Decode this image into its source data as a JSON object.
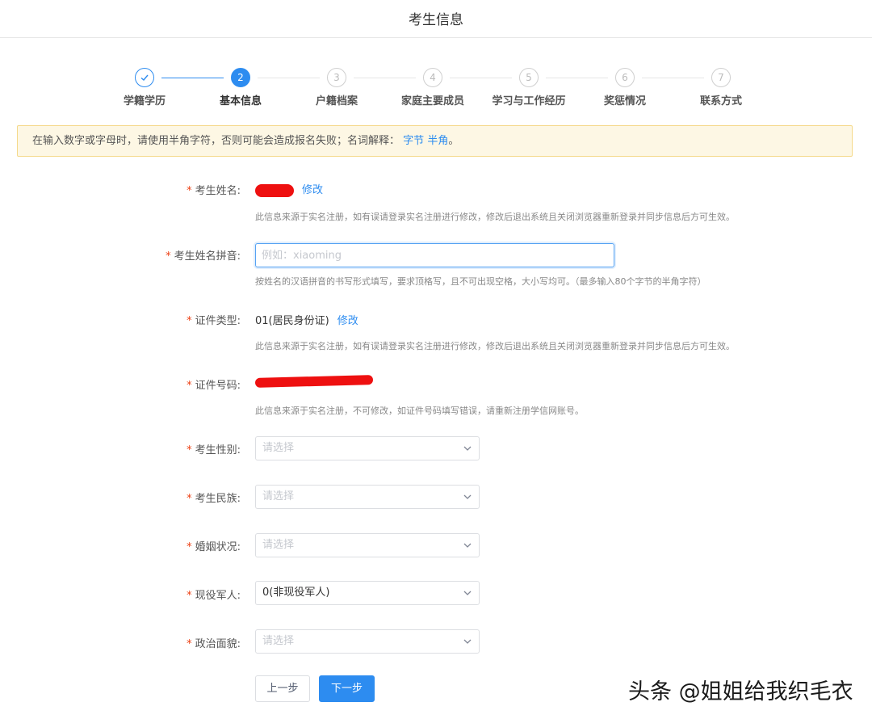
{
  "header": {
    "title": "考生信息"
  },
  "steps": [
    {
      "label": "学籍学历",
      "number": "✓",
      "state": "done"
    },
    {
      "label": "基本信息",
      "number": "2",
      "state": "active"
    },
    {
      "label": "户籍档案",
      "number": "3",
      "state": "pending"
    },
    {
      "label": "家庭主要成员",
      "number": "4",
      "state": "pending"
    },
    {
      "label": "学习与工作经历",
      "number": "5",
      "state": "pending"
    },
    {
      "label": "奖惩情况",
      "number": "6",
      "state": "pending"
    },
    {
      "label": "联系方式",
      "number": "7",
      "state": "pending"
    }
  ],
  "notice": {
    "text": "在输入数字或字母时，请使用半角字符，否则可能会造成报名失败；名词解释：",
    "link_byte": "字节",
    "link_halfwidth": "半角",
    "suffix": "。"
  },
  "form": {
    "required_mark": "*",
    "name": {
      "label": "考生姓名:",
      "edit_link": "修改",
      "hint": "此信息来源于实名注册，如有误请登录实名注册进行修改，修改后退出系统且关闭浏览器重新登录并同步信息后方可生效。"
    },
    "pinyin": {
      "label": "考生姓名拼音:",
      "placeholder": "例如：xiaoming",
      "hint": "按姓名的汉语拼音的书写形式填写，要求顶格写，且不可出现空格，大小写均可。（最多输入80个字节的半角字符）"
    },
    "id_type": {
      "label": "证件类型:",
      "value": "01(居民身份证)",
      "edit_link": "修改",
      "hint": "此信息来源于实名注册，如有误请登录实名注册进行修改，修改后退出系统且关闭浏览器重新登录并同步信息后方可生效。"
    },
    "id_number": {
      "label": "证件号码:",
      "hint": "此信息来源于实名注册，不可修改，如证件号码填写错误，请重新注册学信网账号。"
    },
    "gender": {
      "label": "考生性别:",
      "placeholder": "请选择"
    },
    "ethnicity": {
      "label": "考生民族:",
      "placeholder": "请选择"
    },
    "marital": {
      "label": "婚姻状况:",
      "placeholder": "请选择"
    },
    "military": {
      "label": "现役军人:",
      "value": "0(非现役军人)"
    },
    "political": {
      "label": "政治面貌:",
      "placeholder": "请选择"
    }
  },
  "buttons": {
    "prev": "上一步",
    "next": "下一步"
  },
  "watermark": "头条 @姐姐给我织毛衣",
  "colors": {
    "primary": "#2d8cf0",
    "required": "#ed4014",
    "notice_bg": "#fdf7e4",
    "notice_border": "#f5d98b",
    "redaction": "#ee1010"
  }
}
